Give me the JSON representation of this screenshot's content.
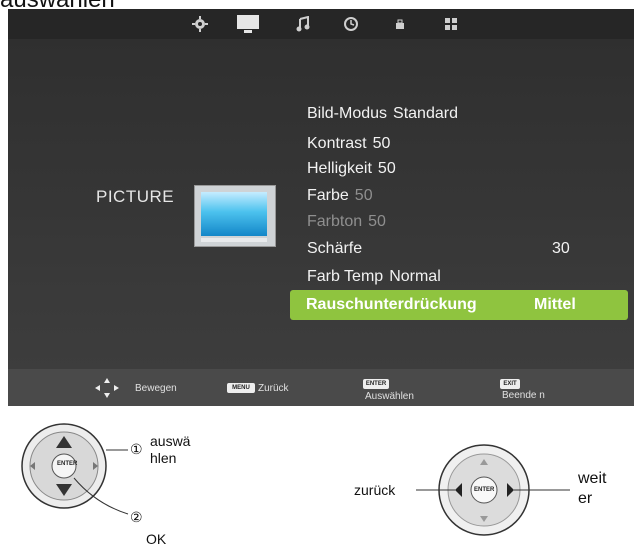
{
  "heading": "auswählen",
  "osd": {
    "tabs": [
      {
        "name": "settings-gear-icon"
      },
      {
        "name": "picture-tv-icon"
      },
      {
        "name": "sound-music-icon"
      },
      {
        "name": "time-clock-icon"
      },
      {
        "name": "lock-icon"
      },
      {
        "name": "setup-grid-icon"
      }
    ],
    "section_label": "PICTURE",
    "menu": [
      {
        "label": "Bild-Modus",
        "value": "Standard"
      },
      {
        "label": "Kontrast",
        "value": "50"
      },
      {
        "label": "Helligkeit",
        "value": "50"
      },
      {
        "label": "Farbe",
        "value": "50"
      },
      {
        "label": "Farbton",
        "value": "50"
      },
      {
        "label": "Schärfe",
        "value": "30"
      },
      {
        "label": "Farb Temp",
        "value": "Normal"
      },
      {
        "label": "Rauschunterdrückung",
        "value": "Mittel"
      }
    ],
    "hints": {
      "move": "Bewegen",
      "menu_key": "MENU",
      "back": "Zurück",
      "enter_key": "ENTER",
      "select": "Auswählen",
      "exit_key": "EXIT",
      "exit": "Beende n"
    },
    "colors": {
      "highlight": "#8fc43f",
      "background": "#3a3a3a"
    }
  },
  "remote_left": {
    "center_key": "ENTER",
    "callout1_num": "①",
    "callout1_text_a": "auswä",
    "callout1_text_b": "hlen",
    "callout2_num": "②",
    "callout2_text": "OK"
  },
  "remote_right": {
    "center_key": "ENTER",
    "left_label": "zurück",
    "right_label_a": "weit",
    "right_label_b": "er"
  }
}
